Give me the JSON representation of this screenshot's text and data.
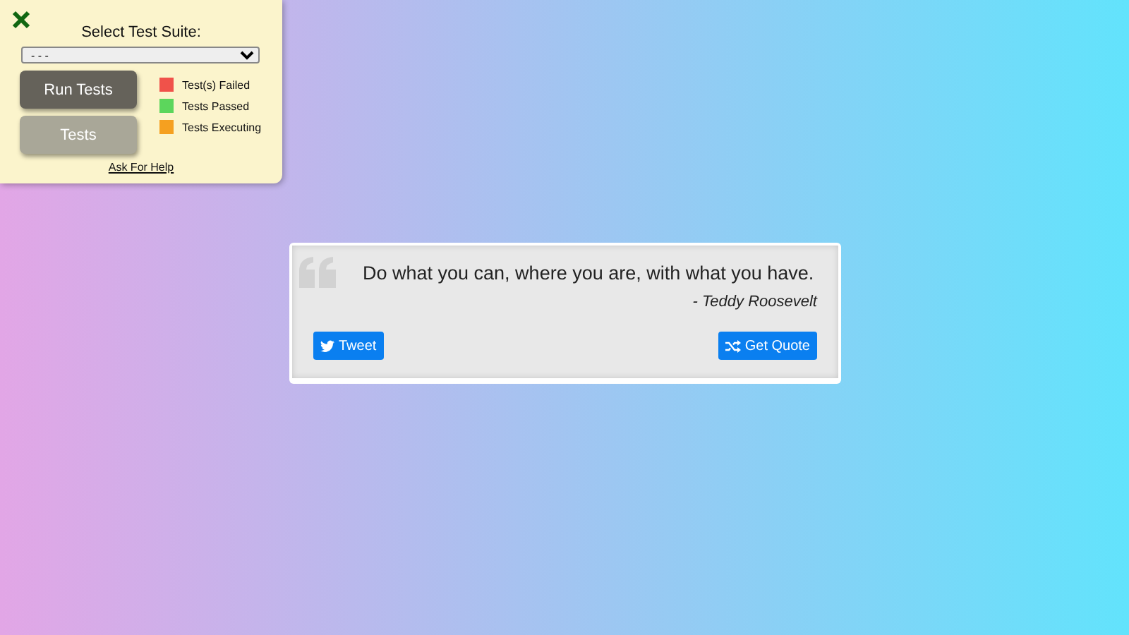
{
  "test_panel": {
    "title": "Select Test Suite:",
    "suite_select": {
      "value": "- - -"
    },
    "buttons": [
      "Run Tests",
      "Tests"
    ],
    "legend": [
      {
        "label": "Test(s) Failed",
        "color": "#f0524a"
      },
      {
        "label": "Tests Passed",
        "color": "#5cd65c"
      },
      {
        "label": "Tests Executing",
        "color": "#f5a020"
      }
    ],
    "help_link": "Ask For Help"
  },
  "quote": {
    "text": "Do what you can, where you are, with what you have.",
    "author": "- Teddy Roosevelt",
    "tweet_button": "Tweet",
    "new_quote_button": "Get Quote"
  }
}
